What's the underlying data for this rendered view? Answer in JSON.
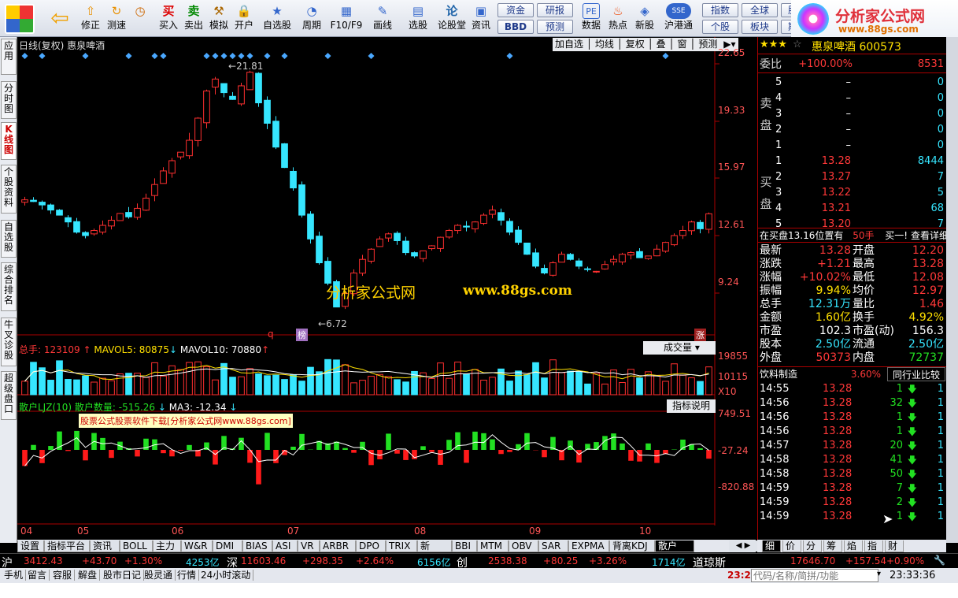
{
  "toolbar": {
    "buttons": [
      {
        "label": "修正",
        "icon": "up-arrow-icon"
      },
      {
        "label": "测速",
        "icon": "clock-icon"
      },
      {
        "label": "买入",
        "icon": "buy-icon"
      },
      {
        "label": "卖出",
        "icon": "sell-icon"
      },
      {
        "label": "模拟",
        "icon": "hammer-icon"
      },
      {
        "label": "开户",
        "icon": "lock-icon"
      },
      {
        "label": "自选股",
        "icon": "star-icon"
      },
      {
        "label": "周期",
        "icon": "cycle-icon"
      },
      {
        "label": "F10/F9",
        "icon": "f10-icon"
      },
      {
        "label": "画线",
        "icon": "pen-icon"
      },
      {
        "label": "选股",
        "icon": "select-icon"
      },
      {
        "label": "论股堂",
        "icon": "forum-icon"
      },
      {
        "label": "资讯",
        "icon": "news-icon"
      },
      {
        "label": "数据",
        "icon": "pe-icon"
      },
      {
        "label": "热点",
        "icon": "hot-icon"
      },
      {
        "label": "新股",
        "icon": "newstock-icon"
      },
      {
        "label": "沪港通",
        "icon": "sse-hkex-icon"
      }
    ],
    "small_buttons": [
      "资金",
      "BBD",
      "研报",
      "预测",
      "指数",
      "个股",
      "全球",
      "板块",
      "股",
      "期"
    ]
  },
  "logo": {
    "title": "分析家公式网",
    "url": "www.88gs.com"
  },
  "left_tabs": [
    "应用",
    "分时图",
    "K线图",
    "个股资料",
    "自选股",
    "综合排名",
    "牛叉诊股",
    "超级盘口"
  ],
  "chart": {
    "title": "日线(复权) 惠泉啤酒",
    "menu": [
      "加自选",
      "均线",
      "复权",
      "叠",
      "窗",
      "预测"
    ],
    "price_axis": [
      "22.65",
      "19.33",
      "15.97",
      "12.61",
      "9.24"
    ],
    "high_label": "21.81",
    "low_label": "6.72",
    "watermark_title": "分析家公式网",
    "watermark_url": "www.88gs.com",
    "markers": {
      "q": "q",
      "bang": "榜",
      "zhang": "涨"
    },
    "vol_header": {
      "total": "总手: 123109",
      "mavol5": "MAVOL5: 80875",
      "mavol10": "MAVOL10: 70880"
    },
    "vol_select": "成交量",
    "vol_axis": [
      "19855",
      "10115",
      "X10"
    ],
    "ind_header": {
      "name": "散户LJZ(10) 散户数量: -515.26",
      "ma3": "MA3: -12.34"
    },
    "ind_help": "指标说明",
    "ind_note": "股票公式股票软件下载[分析家公式网www.88gs.com]",
    "ind_axis": [
      "749.51",
      "-27.24",
      "-820.88"
    ],
    "months": [
      "04",
      "05",
      "06",
      "07",
      "08",
      "09",
      "10"
    ]
  },
  "chart_data": {
    "type": "candlestick",
    "title": "日线(复权) 惠泉啤酒",
    "ylim": [
      6.72,
      22.65
    ],
    "close": [
      14.1,
      14.0,
      13.8,
      13.5,
      13.2,
      12.8,
      12.2,
      12.0,
      12.3,
      12.6,
      12.9,
      13.3,
      13.1,
      13.6,
      14.2,
      15.0,
      15.8,
      16.4,
      16.9,
      17.6,
      18.9,
      20.5,
      21.2,
      20.4,
      20.0,
      20.8,
      21.6,
      19.8,
      18.6,
      17.2,
      16.0,
      14.8,
      13.2,
      11.8,
      10.4,
      9.2,
      7.8,
      8.6,
      9.8,
      10.6,
      11.2,
      11.8,
      12.1,
      11.7,
      11.0,
      10.8,
      11.1,
      11.4,
      11.9,
      12.3,
      12.6,
      12.5,
      12.8,
      13.2,
      13.5,
      12.9,
      12.2,
      11.6,
      10.9,
      10.2,
      9.8,
      10.4,
      10.9,
      10.6,
      10.2,
      10.0,
      9.9,
      10.3,
      10.6,
      10.9,
      11.0,
      10.7,
      10.8,
      11.2,
      11.6,
      12.0,
      12.3,
      12.8,
      12.4,
      13.28
    ]
  },
  "right": {
    "stock_title": "惠泉啤酒 600573",
    "weibi_label": "委比",
    "weibi_value": "+100.00%",
    "weibi_diff": "8531",
    "sell_side": "卖盘",
    "buy_side": "买盘",
    "asks": [
      {
        "lvl": "5",
        "price": "–",
        "vol": "0"
      },
      {
        "lvl": "4",
        "price": "–",
        "vol": "0"
      },
      {
        "lvl": "3",
        "price": "–",
        "vol": "0"
      },
      {
        "lvl": "2",
        "price": "–",
        "vol": "0"
      },
      {
        "lvl": "1",
        "price": "–",
        "vol": "0"
      }
    ],
    "bids": [
      {
        "lvl": "1",
        "price": "13.28",
        "vol": "8444"
      },
      {
        "lvl": "2",
        "price": "13.27",
        "vol": "7"
      },
      {
        "lvl": "3",
        "price": "13.22",
        "vol": "5"
      },
      {
        "lvl": "4",
        "price": "13.21",
        "vol": "68"
      },
      {
        "lvl": "5",
        "price": "13.20",
        "vol": "7"
      }
    ],
    "info_line": {
      "text": "在买盘13.16位置有",
      "hands": "50手",
      "buy1": "买一!",
      "detail": "查看详细"
    },
    "stats": [
      {
        "l1": "最新",
        "v1": "13.28",
        "l2": "开盘",
        "v2": "12.20"
      },
      {
        "l1": "涨跌",
        "v1": "+1.21",
        "l2": "最高",
        "v2": "13.28"
      },
      {
        "l1": "涨幅",
        "v1": "+10.02%",
        "l2": "最低",
        "v2": "12.08"
      },
      {
        "l1": "振幅",
        "v1": "9.94%",
        "l2": "均价",
        "v2": "12.97"
      },
      {
        "l1": "总手",
        "v1": "12.31万",
        "l2": "量比",
        "v2": "1.46"
      },
      {
        "l1": "金额",
        "v1": "1.60亿",
        "l2": "换手",
        "v2": "4.92%"
      },
      {
        "l1": "市盈",
        "v1": "102.3",
        "l2": "市盈(动)",
        "v2": "156.3"
      },
      {
        "l1": "股本",
        "v1": "2.50亿",
        "l2": "流通",
        "v2": "2.50亿"
      },
      {
        "l1": "外盘",
        "v1": "50373",
        "l2": "内盘",
        "v2": "72737"
      }
    ],
    "industry": "饮料制造",
    "industry_pct": "3.60%",
    "industry_btn": "同行业比较",
    "ticks": [
      {
        "t": "14:55",
        "p": "13.28",
        "v": "1",
        "n": "1"
      },
      {
        "t": "14:56",
        "p": "13.28",
        "v": "32",
        "n": "1"
      },
      {
        "t": "14:56",
        "p": "13.28",
        "v": "1",
        "n": "1"
      },
      {
        "t": "14:56",
        "p": "13.28",
        "v": "1",
        "n": "1"
      },
      {
        "t": "14:57",
        "p": "13.28",
        "v": "20",
        "n": "1"
      },
      {
        "t": "14:58",
        "p": "13.28",
        "v": "41",
        "n": "1"
      },
      {
        "t": "14:58",
        "p": "13.28",
        "v": "50",
        "n": "1"
      },
      {
        "t": "14:59",
        "p": "13.28",
        "v": "7",
        "n": "1"
      },
      {
        "t": "14:59",
        "p": "13.28",
        "v": "2",
        "n": "1"
      },
      {
        "t": "14:59",
        "p": "13.28",
        "v": "1",
        "n": "1"
      }
    ],
    "bottom_tabs": [
      "细",
      "价",
      "分",
      "筹",
      "焰",
      "指",
      "财"
    ]
  },
  "bottom_tabs": [
    "设置",
    "指标平台",
    "资讯",
    "BOLL",
    "主力",
    "W&R",
    "DMI",
    "BIAS",
    "ASI",
    "VR",
    "ARBR",
    "DPO",
    "TRIX",
    "新DMA",
    "BBI",
    "MTM",
    "OBV",
    "SAR",
    "EXPMA",
    "背离KDJ",
    "散户LJZ"
  ],
  "index_bar": {
    "sh": {
      "name": "沪",
      "val": "3412.43",
      "chg": "+43.70",
      "pct": "+1.30%",
      "amt": "4253亿"
    },
    "sz": {
      "name": "深",
      "val": "11603.46",
      "chg": "+298.35",
      "pct": "+2.64%",
      "amt": "6156亿"
    },
    "cy": {
      "name": "创",
      "val": "2538.38",
      "chg": "+80.25",
      "pct": "+3.26%",
      "amt": "1714亿"
    },
    "dj": {
      "name": "道琼斯",
      "val": "17646.70",
      "chg": "+157.54",
      "pct": "+0.90%"
    }
  },
  "status": {
    "items": [
      "手机",
      "留言",
      "容服",
      "解盘",
      "股市日记",
      "股灵通",
      "行情",
      "24小时滚动"
    ],
    "time_left": "23:2",
    "search_placeholder": "代码/名称/简拼/功能",
    "time": "23:33:36"
  }
}
